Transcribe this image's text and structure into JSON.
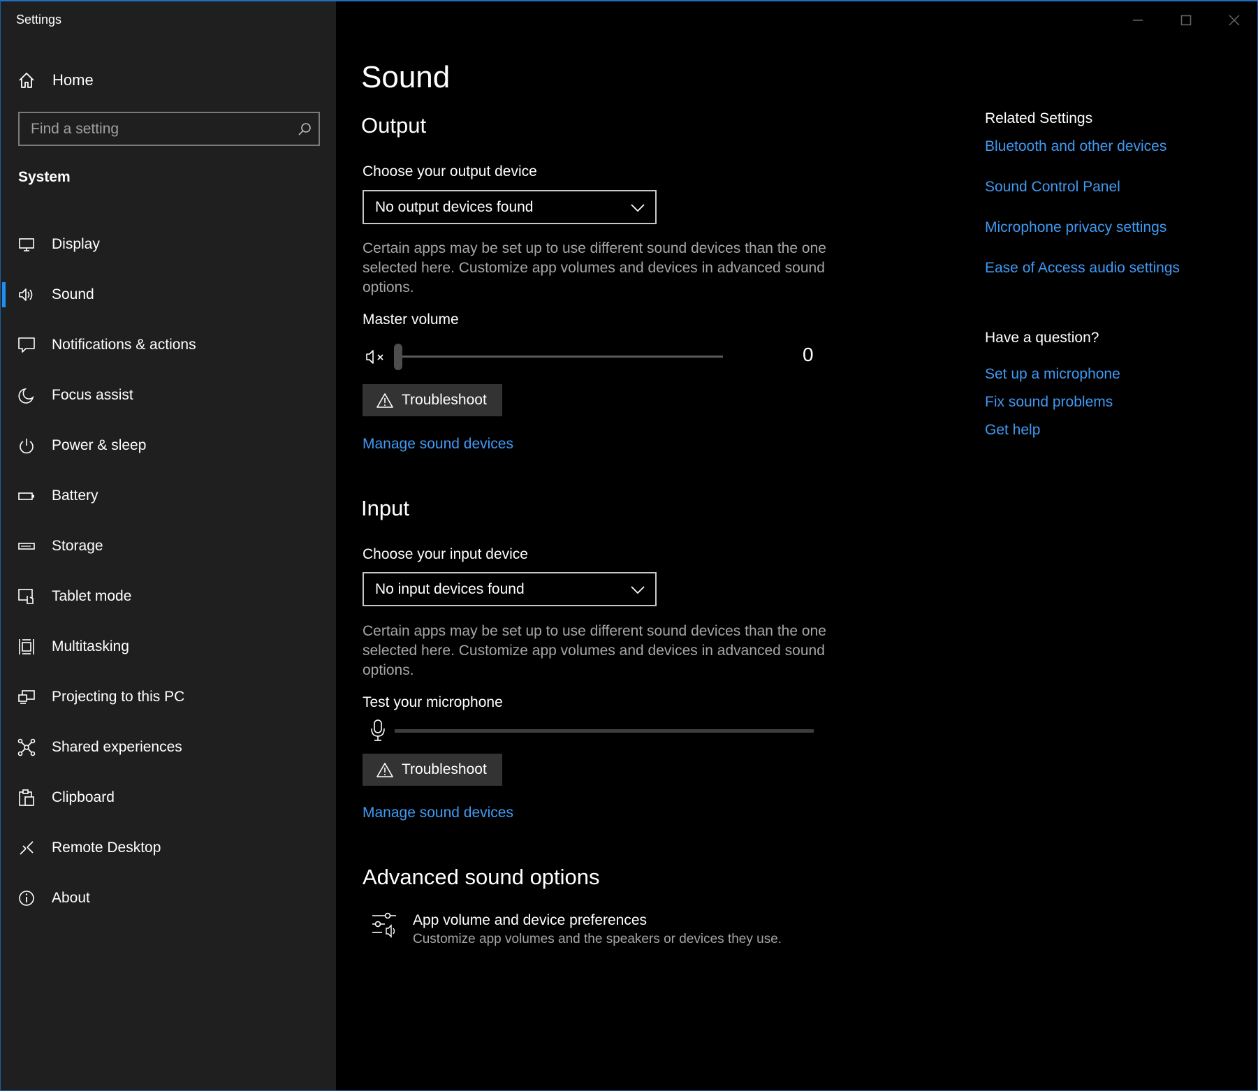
{
  "window": {
    "title": "Settings"
  },
  "sidebar": {
    "home_label": "Home",
    "search_placeholder": "Find a setting",
    "section": "System",
    "items": [
      {
        "label": "Display",
        "icon": "display-icon"
      },
      {
        "label": "Sound",
        "icon": "speaker-icon",
        "active": true
      },
      {
        "label": "Notifications & actions",
        "icon": "notification-icon"
      },
      {
        "label": "Focus assist",
        "icon": "moon-icon"
      },
      {
        "label": "Power & sleep",
        "icon": "power-icon"
      },
      {
        "label": "Battery",
        "icon": "battery-icon"
      },
      {
        "label": "Storage",
        "icon": "storage-icon"
      },
      {
        "label": "Tablet mode",
        "icon": "tablet-icon"
      },
      {
        "label": "Multitasking",
        "icon": "multitasking-icon"
      },
      {
        "label": "Projecting to this PC",
        "icon": "projecting-icon"
      },
      {
        "label": "Shared experiences",
        "icon": "shared-icon"
      },
      {
        "label": "Clipboard",
        "icon": "clipboard-icon"
      },
      {
        "label": "Remote Desktop",
        "icon": "remote-desktop-icon"
      },
      {
        "label": "About",
        "icon": "info-icon"
      }
    ]
  },
  "main": {
    "title": "Sound",
    "output": {
      "heading": "Output",
      "device_label": "Choose your output device",
      "device_value": "No output devices found",
      "description": "Certain apps may be set up to use different sound devices than the one selected here. Customize app volumes and devices in advanced sound options.",
      "volume_label": "Master volume",
      "volume_value": "0",
      "troubleshoot": "Troubleshoot",
      "manage_link": "Manage sound devices"
    },
    "input": {
      "heading": "Input",
      "device_label": "Choose your input device",
      "device_value": "No input devices found",
      "description": "Certain apps may be set up to use different sound devices than the one selected here. Customize app volumes and devices in advanced sound options.",
      "mic_label": "Test your microphone",
      "troubleshoot": "Troubleshoot",
      "manage_link": "Manage sound devices"
    },
    "advanced": {
      "heading": "Advanced sound options",
      "item_title": "App volume and device preferences",
      "item_desc": "Customize app volumes and the speakers or devices they use."
    }
  },
  "right": {
    "related_heading": "Related Settings",
    "related_links": [
      "Bluetooth and other devices",
      "Sound Control Panel",
      "Microphone privacy settings",
      "Ease of Access audio settings"
    ],
    "question_heading": "Have a question?",
    "question_links": [
      "Set up a microphone",
      "Fix sound problems",
      "Get help"
    ]
  },
  "colors": {
    "accent": "#3f9af5",
    "sidebar_bg": "#1f1f1f",
    "main_bg": "#000000",
    "active_bar": "#1f8ff0"
  }
}
